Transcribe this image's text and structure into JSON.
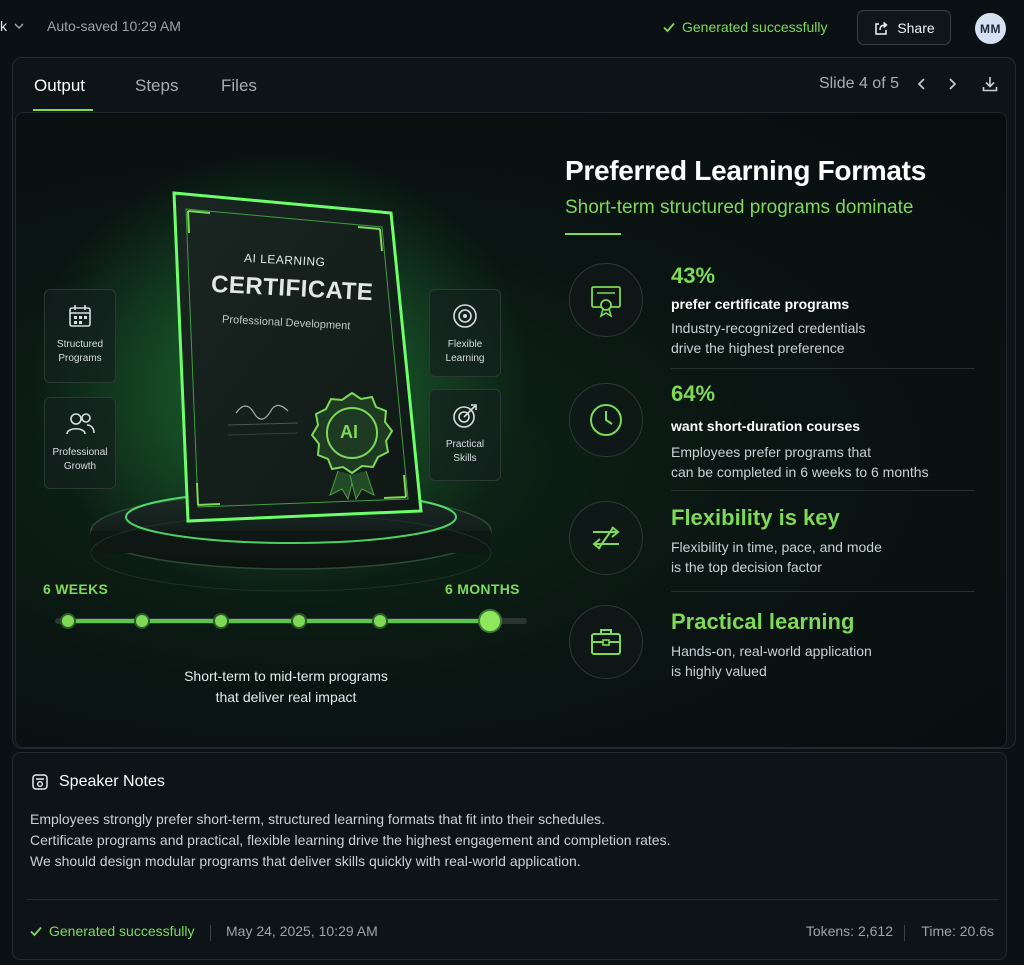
{
  "topbar": {
    "project_fragment": "k",
    "autosaved": "Auto-saved 10:29 AM",
    "status": "Generated successfully",
    "share_label": "Share",
    "avatar_initials": "MM"
  },
  "tabs": [
    {
      "label": "Output",
      "active": true
    },
    {
      "label": "Steps",
      "active": false
    },
    {
      "label": "Files",
      "active": false
    }
  ],
  "slide_nav": {
    "counter": "Slide 4 of 5"
  },
  "slide": {
    "certificate": {
      "line1": "AI LEARNING",
      "line2": "CERTIFICATE",
      "line3": "Professional Development",
      "seal": "AI"
    },
    "side_cards": [
      {
        "line1": "Structured",
        "line2": "Programs",
        "icon": "calendar-icon"
      },
      {
        "line1": "Professional",
        "line2": "Growth",
        "icon": "people-icon"
      },
      {
        "line1": "Flexible",
        "line2": "Learning",
        "icon": "target-icon"
      },
      {
        "line1": "Practical",
        "line2": "Skills",
        "icon": "bullseye-arrow-icon"
      }
    ],
    "timeline": {
      "start_label": "6 WEEKS",
      "end_label": "6 MONTHS",
      "caption_line1": "Short-term to mid-term programs",
      "caption_line2": "that deliver real impact"
    },
    "title": "Preferred Learning Formats",
    "subtitle": "Short-term structured programs dominate",
    "items": [
      {
        "head": "43%",
        "bold": "prefer certificate programs",
        "desc1": "Industry-recognized credentials",
        "desc2": "drive the highest preference",
        "icon": "certificate-icon"
      },
      {
        "head": "64%",
        "bold": "want short-duration courses",
        "desc1": "Employees prefer programs that",
        "desc2": "can be completed in 6 weeks to 6 months",
        "icon": "clock-icon"
      },
      {
        "head": "Flexibility is key",
        "desc1": "Flexibility in time, pace, and mode",
        "desc2": "is the top decision factor",
        "icon": "swap-arrows-icon"
      },
      {
        "head": "Practical learning",
        "desc1": "Hands-on, real-world application",
        "desc2": "is highly valued",
        "icon": "briefcase-icon"
      }
    ]
  },
  "notes": {
    "heading": "Speaker Notes",
    "lines": [
      "Employees strongly prefer short-term, structured learning formats that fit into their schedules.",
      "Certificate programs and practical, flexible learning drive the highest engagement and completion rates.",
      "We should design modular programs that deliver skills quickly with real-world application."
    ],
    "status": "Generated successfully",
    "date": "May 24, 2025, 10:29 AM",
    "tokens": "Tokens: 2,612",
    "time": "Time: 20.6s"
  },
  "colors": {
    "accent": "#7ed957",
    "background": "#0b1014",
    "panel": "#0d1317"
  }
}
